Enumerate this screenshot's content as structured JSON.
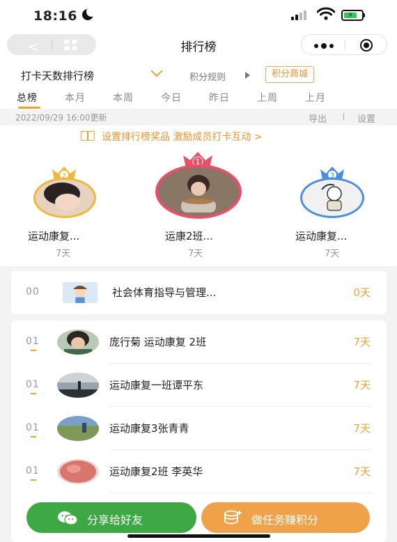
{
  "status_bar": {
    "time": "18:16"
  },
  "nav": {
    "title": "排行榜"
  },
  "selector": {
    "rank_type": "打卡天数排行榜",
    "rules": "积分规则",
    "mall": "积分商城"
  },
  "tabs": [
    "总榜",
    "本月",
    "本周",
    "今日",
    "昨日",
    "上周",
    "上月"
  ],
  "active_tab": "总榜",
  "update": {
    "timestamp": "2022/09/29 16:00更新",
    "export": "导出",
    "divider": "|",
    "settings": "设置"
  },
  "banner": {
    "text": "设置排行榜奖品 激励成员打卡互动 >"
  },
  "podium": [
    {
      "rank": "2",
      "name": "运动康复...",
      "days": "7天",
      "crown_color": "#f0b83a"
    },
    {
      "rank": "1",
      "name": "运康2班...",
      "days": "7天",
      "crown_color": "#e8506a"
    },
    {
      "rank": "3",
      "name": "运动康复...",
      "days": "7天",
      "crown_color": "#4a8fe0"
    }
  ],
  "my_row": {
    "rank": "00",
    "name": "社会体育指导与管理...",
    "days": "0天"
  },
  "list": [
    {
      "rank": "01",
      "name": "庞行菊 运动康复 2班",
      "days": "7天"
    },
    {
      "rank": "01",
      "name": "运动康复一班谭平东",
      "days": "7天"
    },
    {
      "rank": "01",
      "name": "运动康复3张青青",
      "days": "7天"
    },
    {
      "rank": "01",
      "name": "运动康复2班 李英华",
      "days": "7天"
    }
  ],
  "buttons": {
    "share": "分享给好友",
    "task": "做任务赚积分"
  },
  "colors": {
    "accent": "#f0a230",
    "share": "#3ea845",
    "task": "#f0a24a"
  }
}
